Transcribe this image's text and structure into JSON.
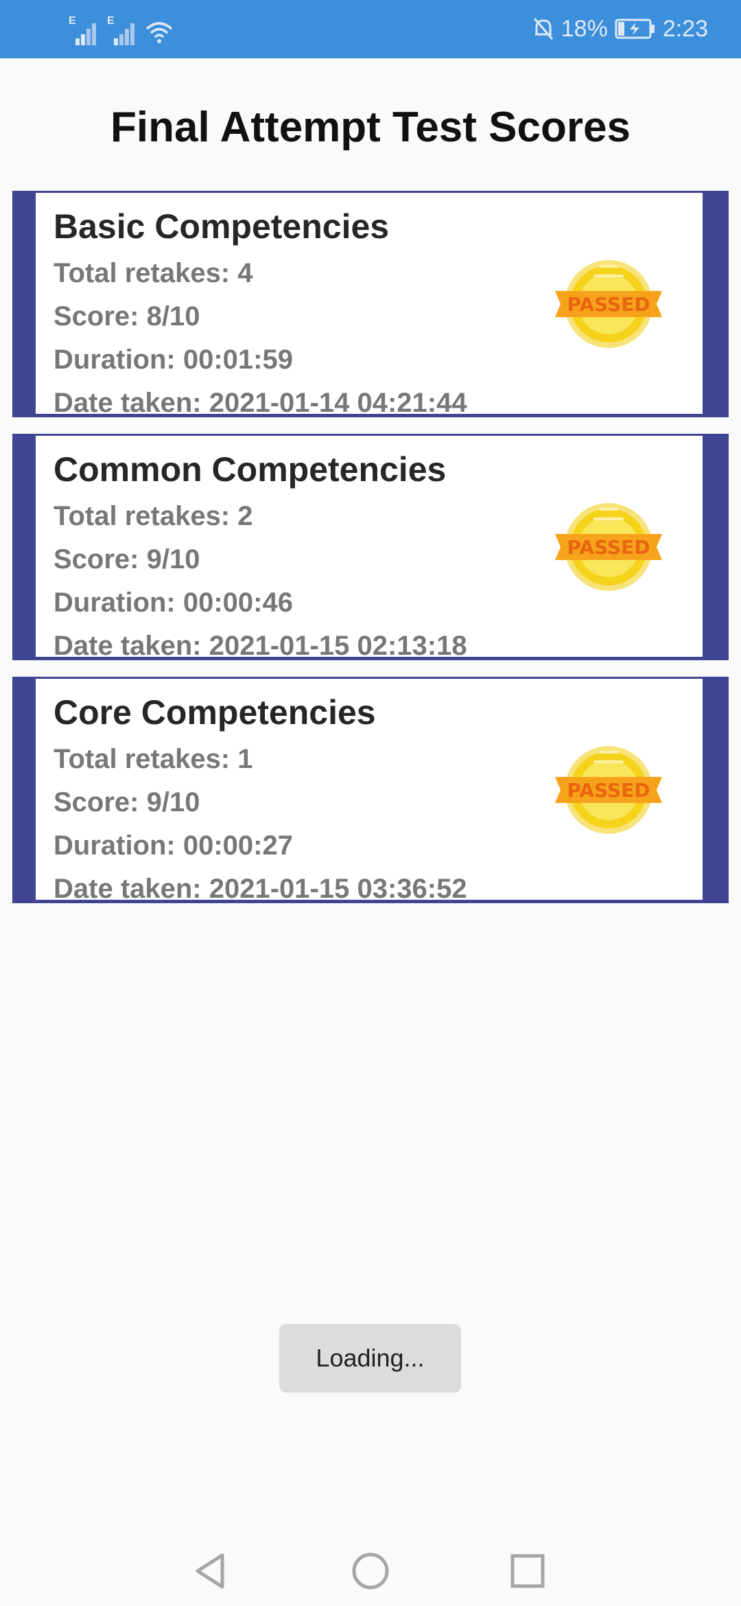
{
  "status_bar": {
    "network_1": "E",
    "network_2": "E",
    "battery_percent": "18%",
    "time": "2:23"
  },
  "page": {
    "title": "Final Attempt Test Scores"
  },
  "cards": [
    {
      "title": "Basic Competencies",
      "retakes": "Total retakes: 4",
      "score": "Score: 8/10",
      "duration": "Duration: 00:01:59",
      "date": "Date taken: 2021-01-14 04:21:44",
      "badge": "PASSED"
    },
    {
      "title": "Common Competencies",
      "retakes": "Total retakes: 2",
      "score": "Score: 9/10",
      "duration": "Duration: 00:00:46",
      "date": "Date taken: 2021-01-15 02:13:18",
      "badge": "PASSED"
    },
    {
      "title": "Core Competencies",
      "retakes": "Total retakes: 1",
      "score": "Score: 9/10",
      "duration": "Duration: 00:00:27",
      "date": "Date taken: 2021-01-15 03:36:52",
      "badge": "PASSED"
    }
  ],
  "toast": {
    "text": "Loading..."
  },
  "nav": {
    "back_icon": "back-triangle-icon",
    "home_icon": "home-circle-icon",
    "recents_icon": "recents-square-icon"
  },
  "colors": {
    "status_bar": "#3c8fdb",
    "card_border": "#3f4493",
    "badge_gold": "#f5d31a",
    "badge_ribbon": "#f7a21b"
  }
}
